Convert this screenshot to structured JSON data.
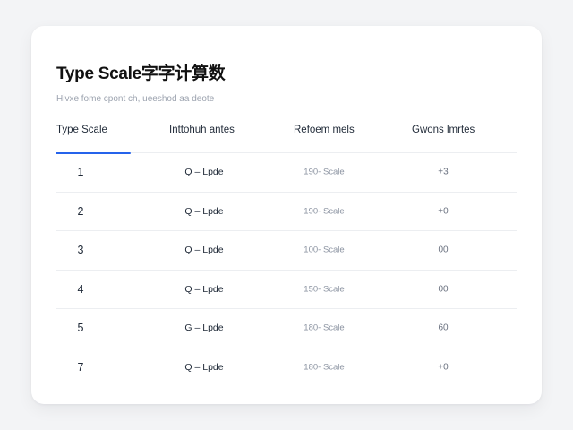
{
  "card": {
    "title": "Type Scale字字计算数",
    "subtitle": "Hivxe fome cpont ch, ueeshod aa deote"
  },
  "tabs": [
    {
      "label": "Type Scale",
      "active": true
    },
    {
      "label": "Inttohuh antes",
      "active": false
    },
    {
      "label": "Refoem mels",
      "active": false
    },
    {
      "label": "Gwons lmrtes",
      "active": false
    }
  ],
  "rows": [
    {
      "index": "1",
      "style": "Q – Lpde",
      "scale": "190- Scale",
      "value": "+3"
    },
    {
      "index": "2",
      "style": "Q – Lpde",
      "scale": "190- Scale",
      "value": "+0"
    },
    {
      "index": "3",
      "style": "Q – Lpde",
      "scale": "100- Scale",
      "value": "00"
    },
    {
      "index": "4",
      "style": "Q – Lpde",
      "scale": "150- Scale",
      "value": "00"
    },
    {
      "index": "5",
      "style": "G – Lpde",
      "scale": "180- Scale",
      "value": "60"
    },
    {
      "index": "7",
      "style": "Q – Lpde",
      "scale": "180- Scale",
      "value": "+0"
    }
  ],
  "colors": {
    "accent": "#2563eb",
    "background": "#f3f4f6",
    "card": "#ffffff",
    "divider": "#eceef1"
  }
}
